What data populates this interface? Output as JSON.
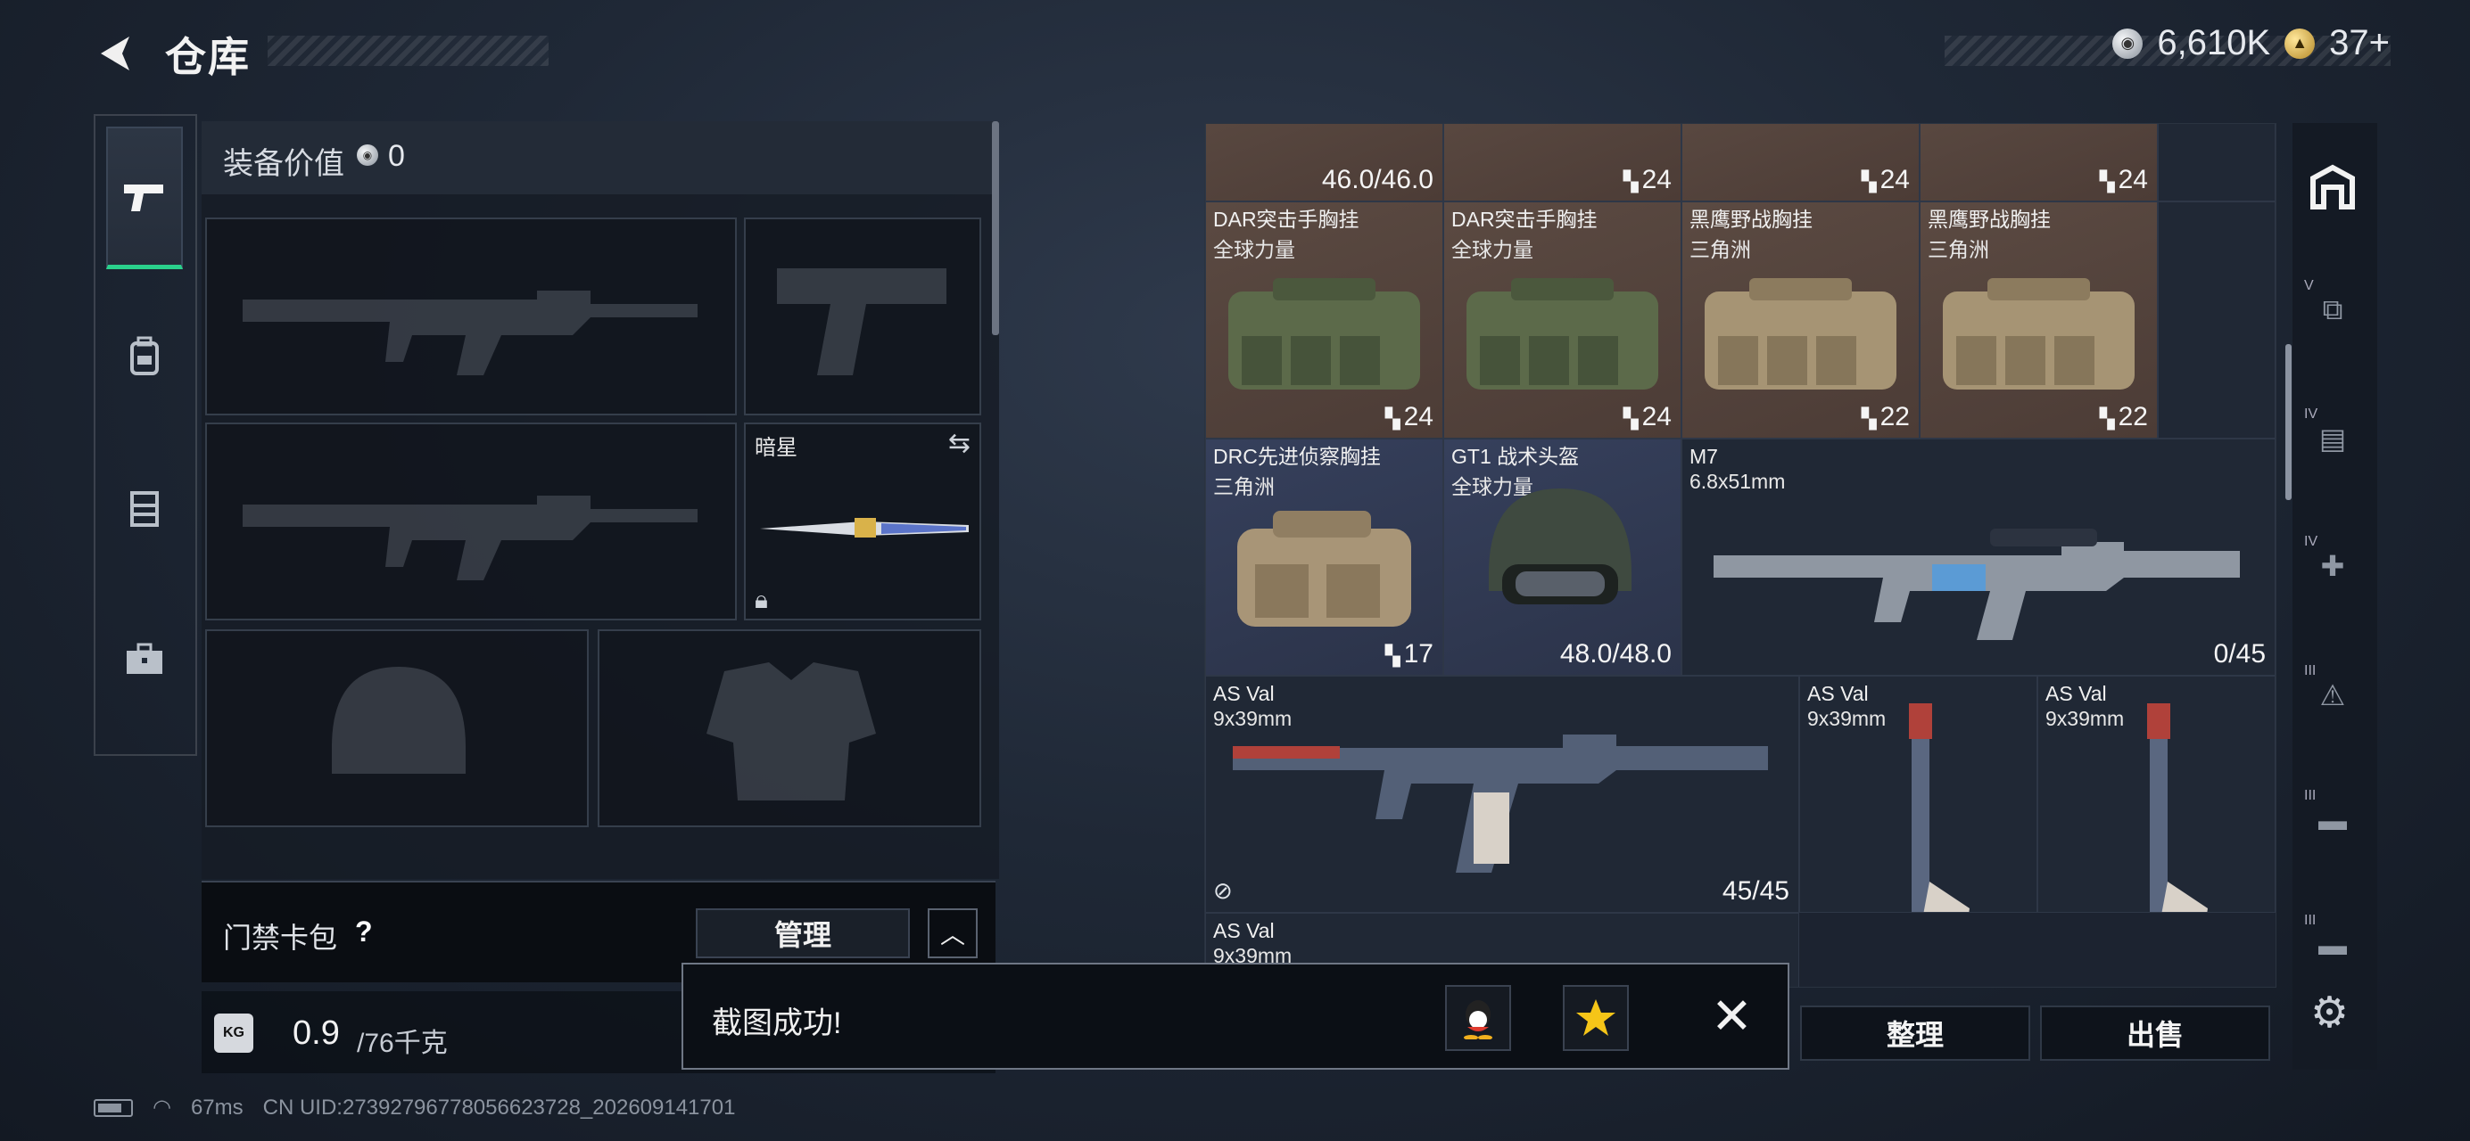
{
  "header": {
    "title": "仓库"
  },
  "currency": {
    "coins": "6,610K",
    "tokens": "37+"
  },
  "loadout": {
    "value_label": "装备价值",
    "value": "0",
    "slots": {
      "melee_name": "暗星"
    },
    "card_pack": {
      "label": "门禁卡包",
      "help": "?",
      "manage": "管理",
      "expand": "^"
    },
    "weight": {
      "current": "0.9",
      "max": "/76千克",
      "icon": "KG"
    }
  },
  "inventory": {
    "items": [
      {
        "name": "",
        "sub": "",
        "count": "46.0/46.0",
        "rarity": "brown"
      },
      {
        "name": "",
        "sub": "",
        "count": "24",
        "rarity": "brown",
        "ammo": true
      },
      {
        "name": "",
        "sub": "",
        "count": "24",
        "rarity": "brown",
        "ammo": true
      },
      {
        "name": "",
        "sub": "",
        "count": "24",
        "rarity": "brown",
        "ammo": true
      },
      {
        "name": "DAR突击手胸挂",
        "sub": "全球力量",
        "count": "24",
        "rarity": "brown",
        "ammo": true
      },
      {
        "name": "DAR突击手胸挂",
        "sub": "全球力量",
        "count": "24",
        "rarity": "brown",
        "ammo": true
      },
      {
        "name": "黑鹰野战胸挂",
        "sub": "三角洲",
        "count": "22",
        "rarity": "brown",
        "ammo": true
      },
      {
        "name": "黑鹰野战胸挂",
        "sub": "三角洲",
        "count": "22",
        "rarity": "brown",
        "ammo": true
      },
      {
        "name": "DRC先进侦察胸挂",
        "sub": "三角洲",
        "count": "17",
        "rarity": "purple",
        "ammo": true
      },
      {
        "name": "GT1 战术头盔",
        "sub": "全球力量",
        "count": "48.0/48.0",
        "rarity": "purple"
      },
      {
        "name": "M7",
        "sub": "6.8x51mm",
        "count": "0/45",
        "rarity": "dark"
      },
      {
        "name": "AS Val",
        "sub": "9x39mm",
        "count": "45/45",
        "rarity": "dark"
      },
      {
        "name": "AS Val",
        "sub": "9x39mm",
        "count": "",
        "rarity": "dark"
      },
      {
        "name": "AS Val",
        "sub": "9x39mm",
        "count": "",
        "rarity": "dark"
      },
      {
        "name": "AS Val",
        "sub": "9x39mm",
        "count": "",
        "rarity": "dark"
      }
    ],
    "organize": "整理",
    "sell": "出售"
  },
  "toast": {
    "message": "截图成功!"
  },
  "status": {
    "ping": "67ms",
    "uid": "CN UID:27392796778056623728_202609141701"
  },
  "icons": [
    "back-arrow-icon",
    "silver-coin-icon",
    "gold-token-icon",
    "pistol-icon",
    "backpack-icon",
    "vest-icon",
    "briefcase-icon",
    "lock-icon",
    "swap-icon",
    "weight-icon",
    "ammo-icon",
    "settings-gear-icon",
    "close-icon",
    "qq-icon",
    "star-icon",
    "wifi-icon",
    "battery-icon"
  ],
  "colors": {
    "accent_green": "#2ad18c",
    "rarity_brown": "#5b4a42",
    "rarity_purple": "#36405c"
  }
}
